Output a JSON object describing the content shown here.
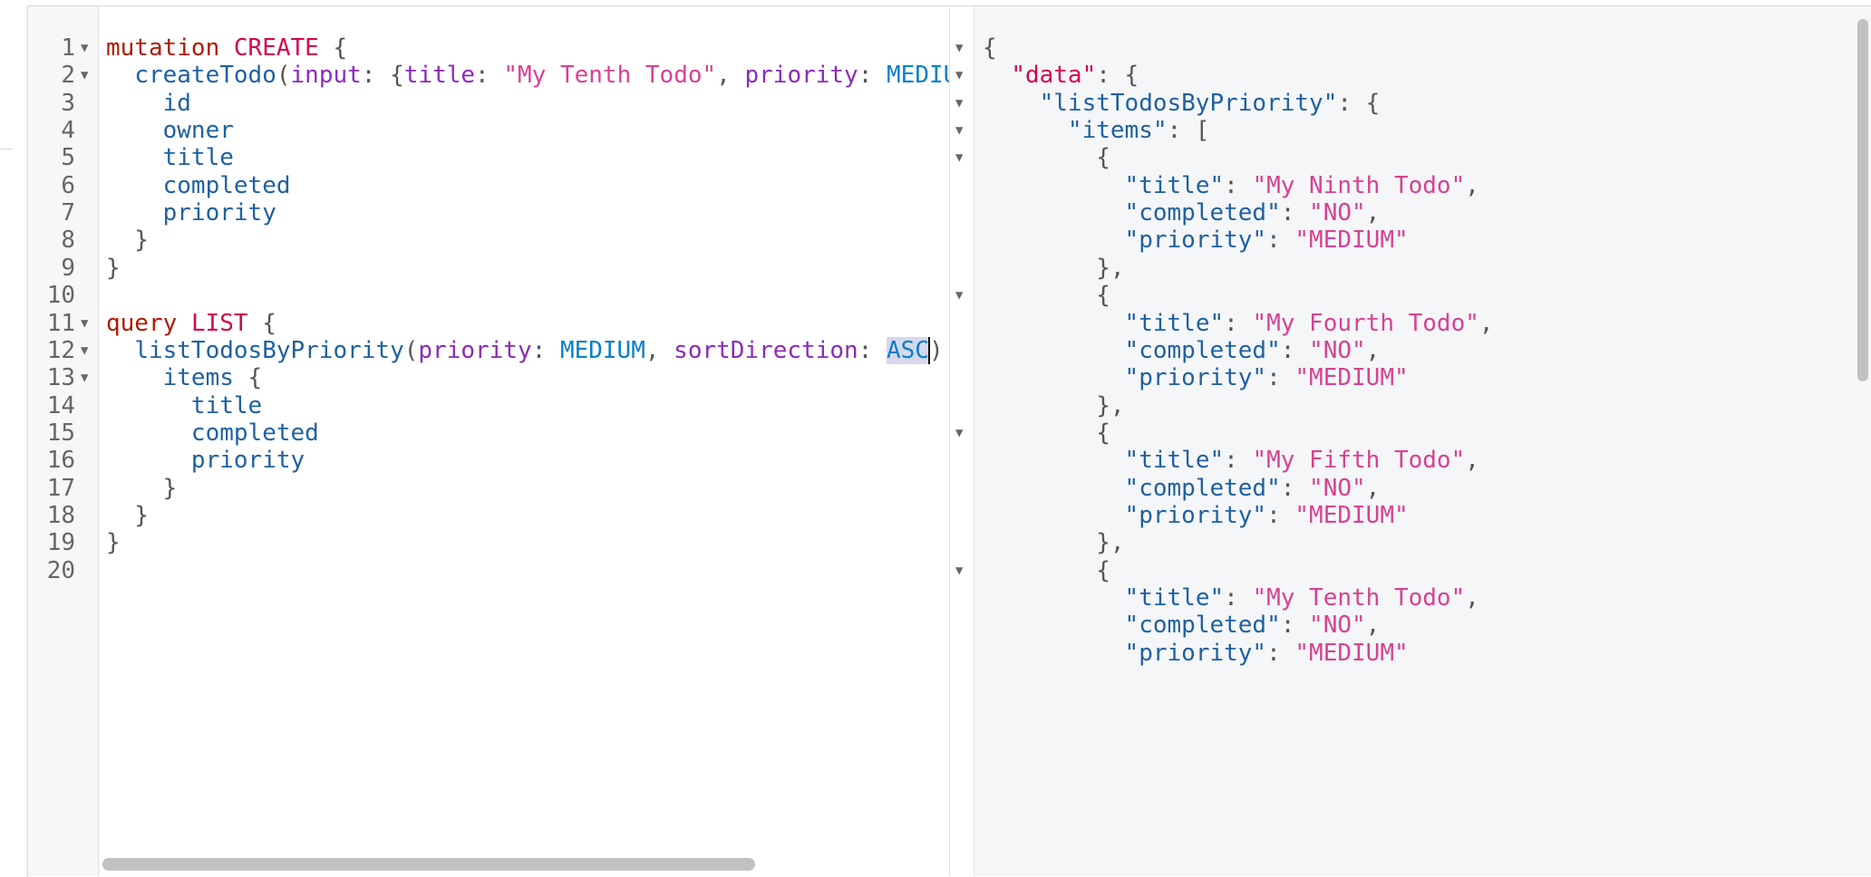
{
  "editor": {
    "lines": [
      {
        "n": "1",
        "fold": "▼",
        "tokens": [
          {
            "t": "mutation",
            "c": "kw"
          },
          {
            "t": " ",
            "c": "punct"
          },
          {
            "t": "CREATE",
            "c": "def"
          },
          {
            "t": " {",
            "c": "punct"
          }
        ]
      },
      {
        "n": "2",
        "fold": "▼",
        "tokens": [
          {
            "t": "  ",
            "c": "punct"
          },
          {
            "t": "createTodo",
            "c": "field"
          },
          {
            "t": "(",
            "c": "punct"
          },
          {
            "t": "input",
            "c": "arg"
          },
          {
            "t": ": {",
            "c": "punct"
          },
          {
            "t": "title",
            "c": "arg"
          },
          {
            "t": ": ",
            "c": "punct"
          },
          {
            "t": "\"My Tenth Todo\"",
            "c": "str"
          },
          {
            "t": ", ",
            "c": "punct"
          },
          {
            "t": "priority",
            "c": "arg"
          },
          {
            "t": ": ",
            "c": "punct"
          },
          {
            "t": "MEDIUM",
            "c": "enum"
          }
        ]
      },
      {
        "n": "3",
        "fold": "",
        "tokens": [
          {
            "t": "    ",
            "c": "punct"
          },
          {
            "t": "id",
            "c": "field"
          }
        ]
      },
      {
        "n": "4",
        "fold": "",
        "tokens": [
          {
            "t": "    ",
            "c": "punct"
          },
          {
            "t": "owner",
            "c": "field"
          }
        ]
      },
      {
        "n": "5",
        "fold": "",
        "tokens": [
          {
            "t": "    ",
            "c": "punct"
          },
          {
            "t": "title",
            "c": "field"
          }
        ]
      },
      {
        "n": "6",
        "fold": "",
        "tokens": [
          {
            "t": "    ",
            "c": "punct"
          },
          {
            "t": "completed",
            "c": "field"
          }
        ]
      },
      {
        "n": "7",
        "fold": "",
        "tokens": [
          {
            "t": "    ",
            "c": "punct"
          },
          {
            "t": "priority",
            "c": "field"
          }
        ]
      },
      {
        "n": "8",
        "fold": "",
        "tokens": [
          {
            "t": "  }",
            "c": "punct"
          }
        ]
      },
      {
        "n": "9",
        "fold": "",
        "tokens": [
          {
            "t": "}",
            "c": "punct"
          }
        ]
      },
      {
        "n": "10",
        "fold": "",
        "tokens": []
      },
      {
        "n": "11",
        "fold": "▼",
        "tokens": [
          {
            "t": "query",
            "c": "kw"
          },
          {
            "t": " ",
            "c": "punct"
          },
          {
            "t": "LIST",
            "c": "def"
          },
          {
            "t": " {",
            "c": "punct"
          }
        ]
      },
      {
        "n": "12",
        "fold": "▼",
        "tokens": [
          {
            "t": "  ",
            "c": "punct"
          },
          {
            "t": "listTodosByPriority",
            "c": "field"
          },
          {
            "t": "(",
            "c": "punct"
          },
          {
            "t": "priority",
            "c": "arg"
          },
          {
            "t": ": ",
            "c": "punct"
          },
          {
            "t": "MEDIUM",
            "c": "enum"
          },
          {
            "t": ", ",
            "c": "punct"
          },
          {
            "t": "sortDirection",
            "c": "arg"
          },
          {
            "t": ": ",
            "c": "punct"
          },
          {
            "t": "ASC",
            "c": "enum sel"
          },
          {
            "t": "CARET",
            "c": "caret"
          },
          {
            "t": ")",
            "c": "punct"
          }
        ]
      },
      {
        "n": "13",
        "fold": "▼",
        "tokens": [
          {
            "t": "    ",
            "c": "punct"
          },
          {
            "t": "items",
            "c": "field"
          },
          {
            "t": " {",
            "c": "punct"
          }
        ]
      },
      {
        "n": "14",
        "fold": "",
        "tokens": [
          {
            "t": "      ",
            "c": "punct"
          },
          {
            "t": "title",
            "c": "field"
          }
        ]
      },
      {
        "n": "15",
        "fold": "",
        "tokens": [
          {
            "t": "      ",
            "c": "punct"
          },
          {
            "t": "completed",
            "c": "field"
          }
        ]
      },
      {
        "n": "16",
        "fold": "",
        "tokens": [
          {
            "t": "      ",
            "c": "punct"
          },
          {
            "t": "priority",
            "c": "field"
          }
        ]
      },
      {
        "n": "17",
        "fold": "",
        "tokens": [
          {
            "t": "    }",
            "c": "punct"
          }
        ]
      },
      {
        "n": "18",
        "fold": "",
        "tokens": [
          {
            "t": "  }",
            "c": "punct"
          }
        ]
      },
      {
        "n": "19",
        "fold": "",
        "tokens": [
          {
            "t": "}",
            "c": "punct"
          }
        ]
      },
      {
        "n": "20",
        "fold": "",
        "tokens": []
      }
    ]
  },
  "result": {
    "lines": [
      {
        "fold": "▼",
        "tokens": [
          {
            "t": "{",
            "c": "punct"
          }
        ]
      },
      {
        "fold": "▼",
        "tokens": [
          {
            "t": "  ",
            "c": "punct"
          },
          {
            "t": "\"data\"",
            "c": "rkey-def"
          },
          {
            "t": ": {",
            "c": "punct"
          }
        ]
      },
      {
        "fold": "▼",
        "tokens": [
          {
            "t": "    ",
            "c": "punct"
          },
          {
            "t": "\"listTodosByPriority\"",
            "c": "key"
          },
          {
            "t": ": {",
            "c": "punct"
          }
        ]
      },
      {
        "fold": "▼",
        "tokens": [
          {
            "t": "      ",
            "c": "punct"
          },
          {
            "t": "\"items\"",
            "c": "key"
          },
          {
            "t": ": [",
            "c": "punct"
          }
        ]
      },
      {
        "fold": "▼",
        "tokens": [
          {
            "t": "        {",
            "c": "punct"
          }
        ]
      },
      {
        "fold": "",
        "tokens": [
          {
            "t": "          ",
            "c": "punct"
          },
          {
            "t": "\"title\"",
            "c": "key"
          },
          {
            "t": ": ",
            "c": "punct"
          },
          {
            "t": "\"My Ninth Todo\"",
            "c": "str"
          },
          {
            "t": ",",
            "c": "punct"
          }
        ]
      },
      {
        "fold": "",
        "tokens": [
          {
            "t": "          ",
            "c": "punct"
          },
          {
            "t": "\"completed\"",
            "c": "key"
          },
          {
            "t": ": ",
            "c": "punct"
          },
          {
            "t": "\"NO\"",
            "c": "str"
          },
          {
            "t": ",",
            "c": "punct"
          }
        ]
      },
      {
        "fold": "",
        "tokens": [
          {
            "t": "          ",
            "c": "punct"
          },
          {
            "t": "\"priority\"",
            "c": "key"
          },
          {
            "t": ": ",
            "c": "punct"
          },
          {
            "t": "\"MEDIUM\"",
            "c": "str"
          }
        ]
      },
      {
        "fold": "",
        "tokens": [
          {
            "t": "        },",
            "c": "punct"
          }
        ]
      },
      {
        "fold": "▼",
        "tokens": [
          {
            "t": "        {",
            "c": "punct"
          }
        ]
      },
      {
        "fold": "",
        "tokens": [
          {
            "t": "          ",
            "c": "punct"
          },
          {
            "t": "\"title\"",
            "c": "key"
          },
          {
            "t": ": ",
            "c": "punct"
          },
          {
            "t": "\"My Fourth Todo\"",
            "c": "str"
          },
          {
            "t": ",",
            "c": "punct"
          }
        ]
      },
      {
        "fold": "",
        "tokens": [
          {
            "t": "          ",
            "c": "punct"
          },
          {
            "t": "\"completed\"",
            "c": "key"
          },
          {
            "t": ": ",
            "c": "punct"
          },
          {
            "t": "\"NO\"",
            "c": "str"
          },
          {
            "t": ",",
            "c": "punct"
          }
        ]
      },
      {
        "fold": "",
        "tokens": [
          {
            "t": "          ",
            "c": "punct"
          },
          {
            "t": "\"priority\"",
            "c": "key"
          },
          {
            "t": ": ",
            "c": "punct"
          },
          {
            "t": "\"MEDIUM\"",
            "c": "str"
          }
        ]
      },
      {
        "fold": "",
        "tokens": [
          {
            "t": "        },",
            "c": "punct"
          }
        ]
      },
      {
        "fold": "▼",
        "tokens": [
          {
            "t": "        {",
            "c": "punct"
          }
        ]
      },
      {
        "fold": "",
        "tokens": [
          {
            "t": "          ",
            "c": "punct"
          },
          {
            "t": "\"title\"",
            "c": "key"
          },
          {
            "t": ": ",
            "c": "punct"
          },
          {
            "t": "\"My Fifth Todo\"",
            "c": "str"
          },
          {
            "t": ",",
            "c": "punct"
          }
        ]
      },
      {
        "fold": "",
        "tokens": [
          {
            "t": "          ",
            "c": "punct"
          },
          {
            "t": "\"completed\"",
            "c": "key"
          },
          {
            "t": ": ",
            "c": "punct"
          },
          {
            "t": "\"NO\"",
            "c": "str"
          },
          {
            "t": ",",
            "c": "punct"
          }
        ]
      },
      {
        "fold": "",
        "tokens": [
          {
            "t": "          ",
            "c": "punct"
          },
          {
            "t": "\"priority\"",
            "c": "key"
          },
          {
            "t": ": ",
            "c": "punct"
          },
          {
            "t": "\"MEDIUM\"",
            "c": "str"
          }
        ]
      },
      {
        "fold": "",
        "tokens": [
          {
            "t": "        },",
            "c": "punct"
          }
        ]
      },
      {
        "fold": "▼",
        "tokens": [
          {
            "t": "        {",
            "c": "punct"
          }
        ]
      },
      {
        "fold": "",
        "tokens": [
          {
            "t": "          ",
            "c": "punct"
          },
          {
            "t": "\"title\"",
            "c": "key"
          },
          {
            "t": ": ",
            "c": "punct"
          },
          {
            "t": "\"My Tenth Todo\"",
            "c": "str"
          },
          {
            "t": ",",
            "c": "punct"
          }
        ]
      },
      {
        "fold": "",
        "tokens": [
          {
            "t": "          ",
            "c": "punct"
          },
          {
            "t": "\"completed\"",
            "c": "key"
          },
          {
            "t": ": ",
            "c": "punct"
          },
          {
            "t": "\"NO\"",
            "c": "str"
          },
          {
            "t": ",",
            "c": "punct"
          }
        ]
      },
      {
        "fold": "",
        "tokens": [
          {
            "t": "          ",
            "c": "punct"
          },
          {
            "t": "\"priority\"",
            "c": "key"
          },
          {
            "t": ": ",
            "c": "punct"
          },
          {
            "t": "\"MEDIUM\"",
            "c": "str"
          }
        ]
      }
    ]
  }
}
